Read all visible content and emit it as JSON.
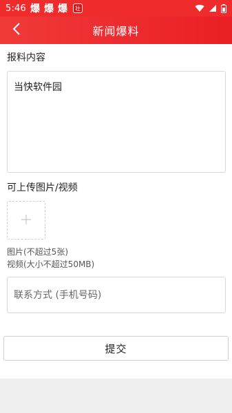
{
  "status_bar": {
    "time": "5:46",
    "app_icons": [
      "爆",
      "爆",
      "爆"
    ],
    "badge_text": "壮"
  },
  "header": {
    "title": "新闻爆料",
    "back_icon": "chevron-left-icon"
  },
  "form": {
    "content_label": "报料内容",
    "content_value": "当快软件园",
    "upload_label": "可上传图片/视频",
    "upload_icon": "plus-icon",
    "image_hint": "图片(不超过5张)",
    "video_hint": "视频(大小不超过50MB)",
    "contact_placeholder": "联系方式 (手机号码)",
    "submit_label": "提交"
  },
  "colors": {
    "accent": "#ef2b2b",
    "background": "#ffffff",
    "bottom_bar": "#efefef"
  }
}
